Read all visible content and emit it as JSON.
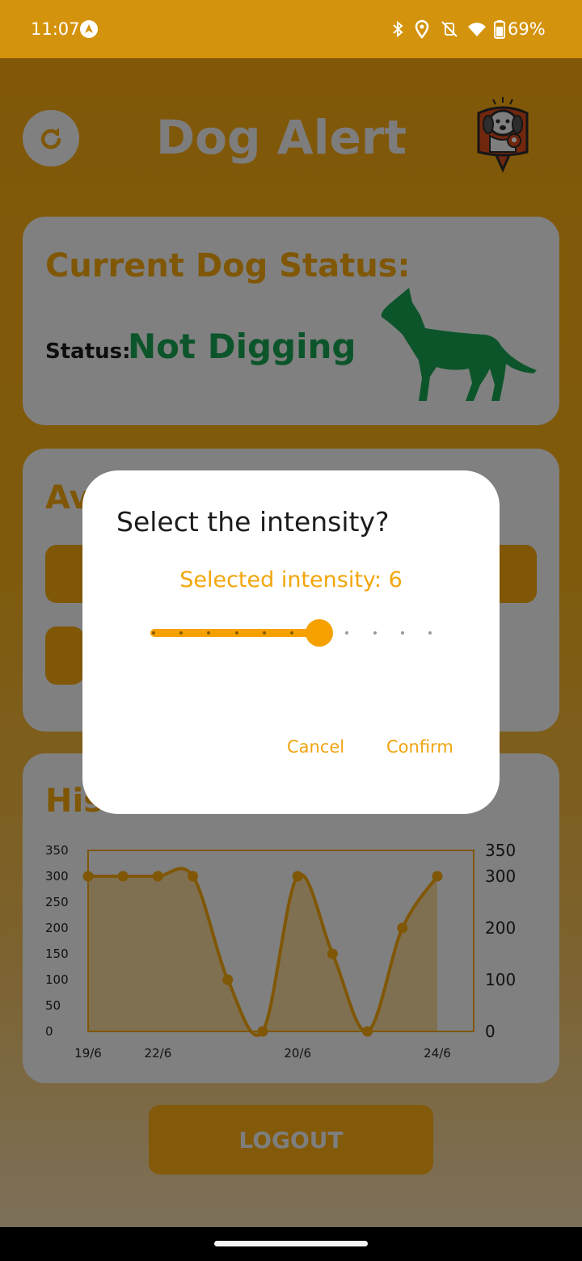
{
  "status_bar": {
    "time": "11:07",
    "battery": "69%"
  },
  "header": {
    "title": "Dog Alert"
  },
  "status_card": {
    "heading": "Current Dog Status:",
    "status_label": "Status:",
    "status_value": "Not Digging",
    "status_color": "#17a050"
  },
  "actions_card": {
    "heading": "Av"
  },
  "history_card": {
    "heading": "His"
  },
  "chart_data": {
    "type": "area",
    "categories": [
      "19/6",
      "22/6",
      "20/6",
      "24/6"
    ],
    "x": [
      "19/6",
      "",
      "22/6",
      "",
      "",
      "",
      "20/6",
      "",
      "",
      "",
      "24/6"
    ],
    "values": [
      300,
      300,
      300,
      300,
      100,
      0,
      300,
      150,
      0,
      200,
      300
    ],
    "left_ticks": [
      "350",
      "300",
      "250",
      "200",
      "150",
      "100",
      "50",
      "0"
    ],
    "right_ticks": [
      "350",
      "300",
      "200",
      "100",
      "0"
    ],
    "ylim": [
      0,
      350
    ],
    "color": "#f0a40d"
  },
  "logout_label": "LOGOUT",
  "dialog": {
    "title": "Select the intensity?",
    "selected_text": "Selected intensity: 6",
    "slider_value": 6,
    "slider_max": 10,
    "cancel_label": "Cancel",
    "confirm_label": "Confirm",
    "accent": "#f6a100"
  }
}
